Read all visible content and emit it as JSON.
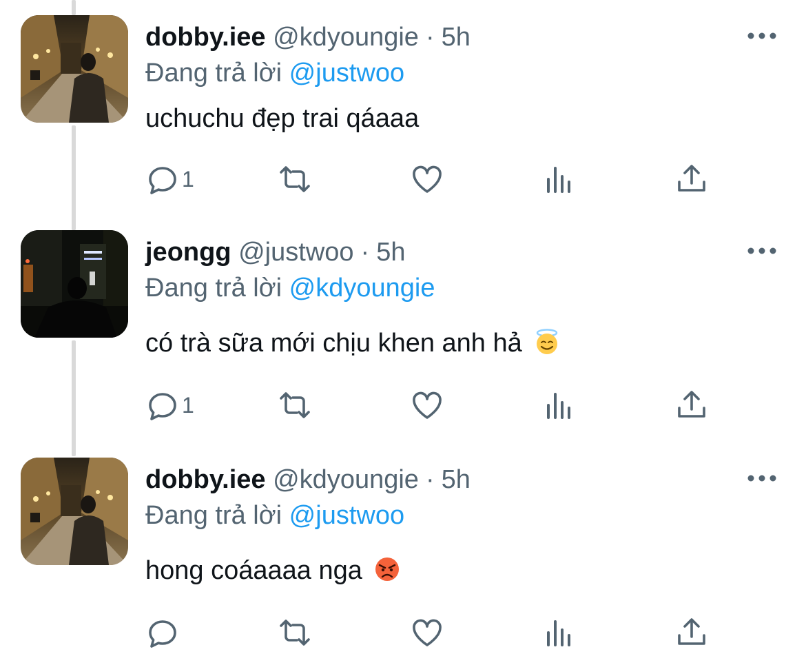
{
  "reply_prefix": "Đang trả lời",
  "tweets": [
    {
      "name": "dobby.iee",
      "handle": "@kdyoungie",
      "separator": "·",
      "time": "5h",
      "replying_to": "@justwoo",
      "text": "uchuchu đẹp trai qáaaa",
      "emoji": "",
      "reply_count": "1",
      "avatar": "street-night-photo"
    },
    {
      "name": "jeongg",
      "handle": "@justwoo",
      "separator": "·",
      "time": "5h",
      "replying_to": "@kdyoungie",
      "text": "có trà sữa mới chịu khen anh hả",
      "emoji": "smiling-face-with-halo",
      "reply_count": "1",
      "avatar": "dark-city-night-photo"
    },
    {
      "name": "dobby.iee",
      "handle": "@kdyoungie",
      "separator": "·",
      "time": "5h",
      "replying_to": "@justwoo",
      "text": "hong coáaaaa nga",
      "emoji": "angry-face",
      "reply_count": "",
      "avatar": "street-night-photo"
    }
  ],
  "colors": {
    "text": "#0f1419",
    "secondary": "#536471",
    "mention": "#1d9bf0",
    "thread_line": "#d9d9d9"
  },
  "icons": [
    "reply-icon",
    "retweet-icon",
    "like-icon",
    "views-icon",
    "share-icon",
    "more-icon"
  ]
}
